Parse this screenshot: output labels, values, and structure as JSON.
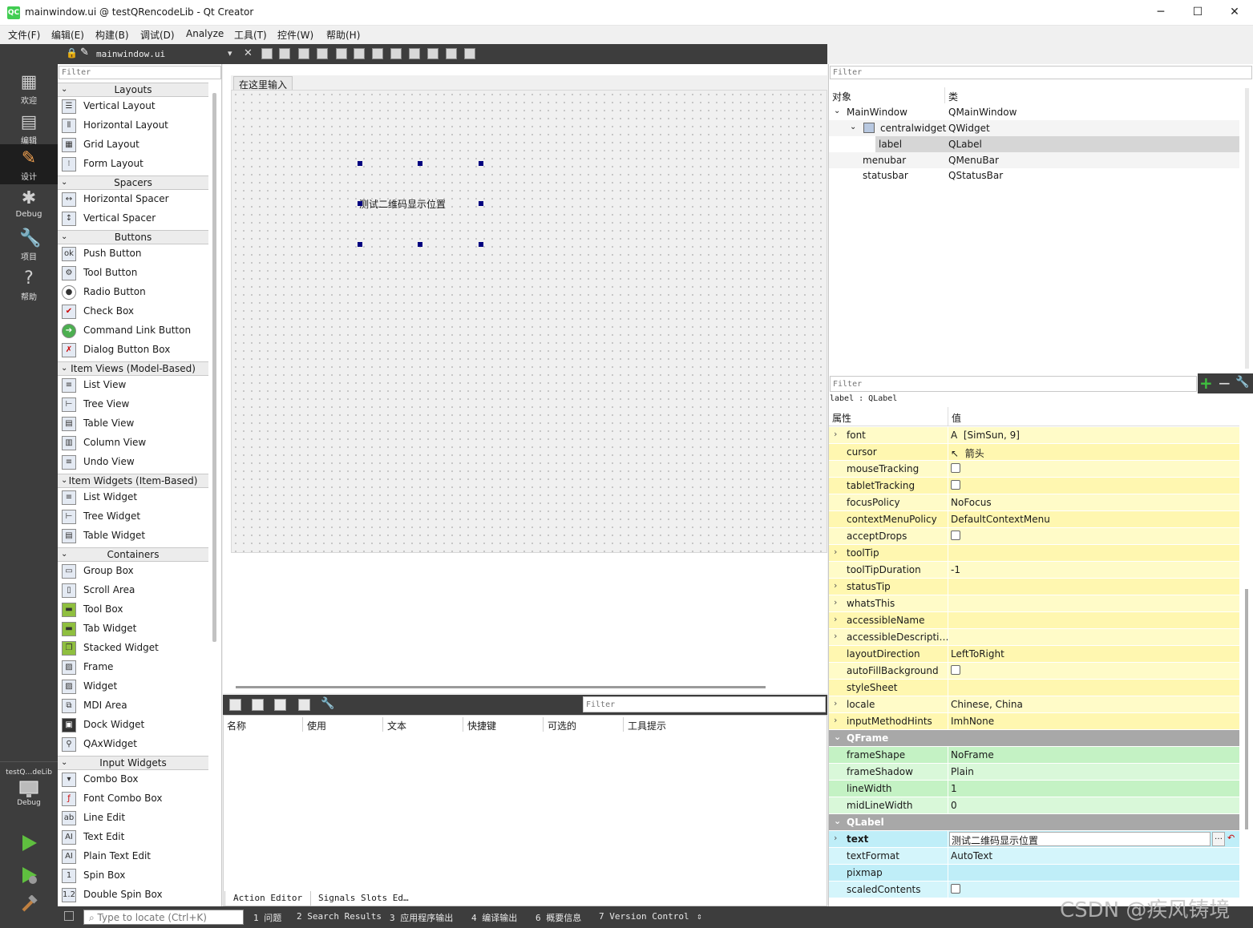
{
  "window": {
    "title": "mainwindow.ui @ testQRencodeLib - Qt Creator",
    "app_icon": "QC",
    "minimize": "─",
    "maximize": "☐",
    "close": "✕"
  },
  "menu": [
    "文件(F)",
    "编辑(E)",
    "构建(B)",
    "调试(D)",
    "Analyze",
    "工具(T)",
    "控件(W)",
    "帮助(H)"
  ],
  "modes": [
    {
      "label": "欢迎",
      "icon": "▦"
    },
    {
      "label": "编辑",
      "icon": "▤"
    },
    {
      "label": "设计",
      "icon": "✎"
    },
    {
      "label": "Debug",
      "icon": "✱"
    },
    {
      "label": "项目",
      "icon": "🔧"
    },
    {
      "label": "帮助",
      "icon": "?"
    }
  ],
  "kit": {
    "project": "testQ…deLib",
    "config": "Debug"
  },
  "doc_toolbar": {
    "file": "mainwindow.ui",
    "dropdown": "▾",
    "close": "✕"
  },
  "widgetbox": {
    "filter_placeholder": "Filter",
    "categories": {
      "layouts": "Layouts",
      "spacers": "Spacers",
      "buttons": "Buttons",
      "item_views": "Item Views (Model-Based)",
      "item_widgets": "Item Widgets (Item-Based)",
      "containers": "Containers",
      "input_widgets": "Input Widgets"
    },
    "items": {
      "vertical_layout": "Vertical Layout",
      "horizontal_layout": "Horizontal Layout",
      "grid_layout": "Grid Layout",
      "form_layout": "Form Layout",
      "horizontal_spacer": "Horizontal Spacer",
      "vertical_spacer": "Vertical Spacer",
      "push_button": "Push Button",
      "tool_button": "Tool Button",
      "radio_button": "Radio Button",
      "check_box": "Check Box",
      "command_link_button": "Command Link Button",
      "dialog_button_box": "Dialog Button Box",
      "list_view": "List View",
      "tree_view": "Tree View",
      "table_view": "Table View",
      "column_view": "Column View",
      "undo_view": "Undo View",
      "list_widget": "List Widget",
      "tree_widget": "Tree Widget",
      "table_widget": "Table Widget",
      "group_box": "Group Box",
      "scroll_area": "Scroll Area",
      "tool_box": "Tool Box",
      "tab_widget": "Tab Widget",
      "stacked_widget": "Stacked Widget",
      "frame": "Frame",
      "widget": "Widget",
      "mdi_area": "MDI Area",
      "dock_widget": "Dock Widget",
      "qaxwidget": "QAxWidget",
      "combo_box": "Combo Box",
      "font_combo_box": "Font Combo Box",
      "line_edit": "Line Edit",
      "text_edit": "Text Edit",
      "plain_text_edit": "Plain Text Edit",
      "spin_box": "Spin Box",
      "double_spin_box": "Double Spin Box"
    }
  },
  "form": {
    "menu_placeholder": "在这里输入",
    "label_text": "测试二维码显示位置"
  },
  "action_editor": {
    "filter_placeholder": "Filter",
    "columns": [
      "名称",
      "使用",
      "文本",
      "快捷键",
      "可选的",
      "工具提示"
    ],
    "tabs": [
      "Action Editor",
      "Signals Slots Ed…"
    ]
  },
  "object_inspector": {
    "filter_placeholder": "Filter",
    "col_object": "对象",
    "col_class": "类",
    "rows": [
      {
        "object": "MainWindow",
        "class": "QMainWindow"
      },
      {
        "object": "centralwidget",
        "class": "QWidget"
      },
      {
        "object": "label",
        "class": "QLabel"
      },
      {
        "object": "menubar",
        "class": "QMenuBar"
      },
      {
        "object": "statusbar",
        "class": "QStatusBar"
      }
    ]
  },
  "property_editor": {
    "filter_placeholder": "Filter",
    "add": "+",
    "remove": "−",
    "context": "label : QLabel",
    "col_prop": "属性",
    "col_value": "值",
    "rows": [
      {
        "name": "font",
        "value": "[SimSun, 9]",
        "expand": "›"
      },
      {
        "name": "cursor",
        "value": "箭头"
      },
      {
        "name": "mouseTracking",
        "value": ""
      },
      {
        "name": "tabletTracking",
        "value": ""
      },
      {
        "name": "focusPolicy",
        "value": "NoFocus"
      },
      {
        "name": "contextMenuPolicy",
        "value": "DefaultContextMenu"
      },
      {
        "name": "acceptDrops",
        "value": ""
      },
      {
        "name": "toolTip",
        "value": "",
        "expand": "›"
      },
      {
        "name": "toolTipDuration",
        "value": "-1"
      },
      {
        "name": "statusTip",
        "value": "",
        "expand": "›"
      },
      {
        "name": "whatsThis",
        "value": "",
        "expand": "›"
      },
      {
        "name": "accessibleName",
        "value": "",
        "expand": "›"
      },
      {
        "name": "accessibleDescripti…",
        "value": "",
        "expand": "›"
      },
      {
        "name": "layoutDirection",
        "value": "LeftToRight"
      },
      {
        "name": "autoFillBackground",
        "value": ""
      },
      {
        "name": "styleSheet",
        "value": ""
      },
      {
        "name": "locale",
        "value": "Chinese, China",
        "expand": "›"
      },
      {
        "name": "inputMethodHints",
        "value": "ImhNone",
        "expand": "›"
      }
    ],
    "qframe_group": "QFrame",
    "qframe_rows": [
      {
        "name": "frameShape",
        "value": "NoFrame"
      },
      {
        "name": "frameShadow",
        "value": "Plain"
      },
      {
        "name": "lineWidth",
        "value": "1"
      },
      {
        "name": "midLineWidth",
        "value": "0"
      }
    ],
    "qlabel_group": "QLabel",
    "qlabel_rows": [
      {
        "name": "text",
        "value": "测试二维码显示位置",
        "expand": "›"
      },
      {
        "name": "textFormat",
        "value": "AutoText"
      },
      {
        "name": "pixmap",
        "value": ""
      },
      {
        "name": "scaledContents",
        "value": ""
      }
    ],
    "text_more": "…"
  },
  "statusbar": {
    "locate_placeholder": "Type to locate (Ctrl+K)",
    "outputs": [
      "1 问题",
      "2 Search Results",
      "3 应用程序输出",
      "4 编译输出",
      "6 概要信息",
      "7 Version Control"
    ],
    "arrows": "⇕"
  },
  "watermark": "CSDN @疾风铸境",
  "colors": {
    "dark_panel": "#3d3d3d",
    "selection_handle": "#00007f",
    "prop_yellow": "#fffbc8",
    "prop_green": "#d9f8d9",
    "prop_cyan": "#d4f5fb",
    "qt_green": "#41cd52"
  }
}
